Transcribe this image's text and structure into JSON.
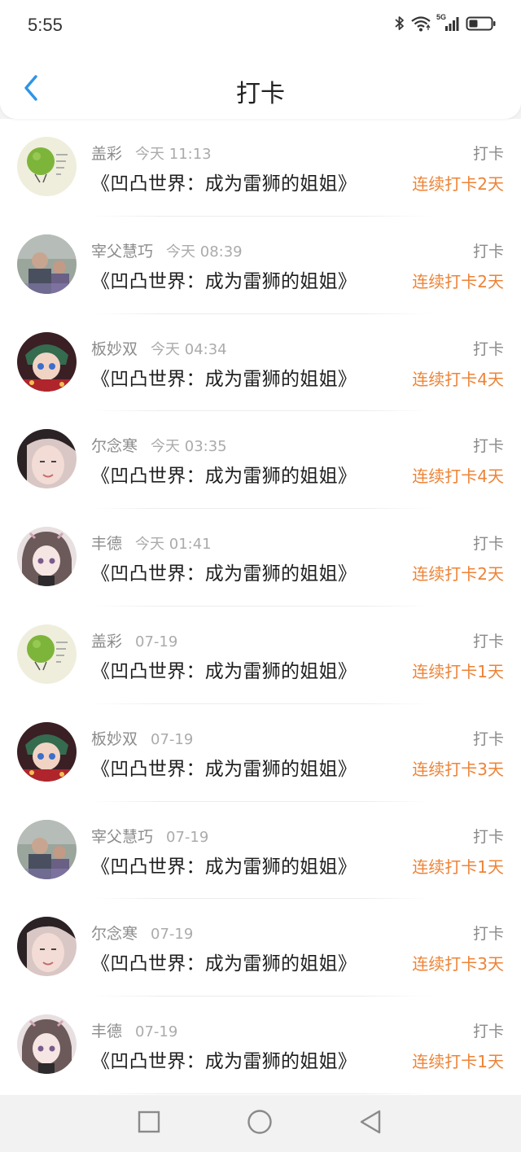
{
  "status_bar": {
    "time": "5:55",
    "icons": [
      "bluetooth-icon",
      "wifi-icon",
      "signal-5g-icon",
      "battery-icon"
    ],
    "network_label": "5G"
  },
  "header": {
    "title": "打卡",
    "back_icon": "chevron-left-icon",
    "accent_color": "#2f94e6"
  },
  "colors": {
    "streak": "#ee8336",
    "name": "#8c8c8c",
    "time": "#ababab",
    "book": "#1f1f1f"
  },
  "list": [
    {
      "name": "盖彩",
      "time": "今天 11:13",
      "book": "《凹凸世界：成为雷狮的姐姐》",
      "action": "打卡",
      "streak": "连续打卡2天",
      "avatar": "lime"
    },
    {
      "name": "宰父慧巧",
      "time": "今天 08:39",
      "book": "《凹凸世界：成为雷狮的姐姐》",
      "action": "打卡",
      "streak": "连续打卡2天",
      "avatar": "photo"
    },
    {
      "name": "板妙双",
      "time": "今天 04:34",
      "book": "《凹凸世界：成为雷狮的姐姐》",
      "action": "打卡",
      "streak": "连续打卡4天",
      "avatar": "anime-red"
    },
    {
      "name": "尔念寒",
      "time": "今天 03:35",
      "book": "《凹凸世界：成为雷狮的姐姐》",
      "action": "打卡",
      "streak": "连续打卡4天",
      "avatar": "face"
    },
    {
      "name": "丰德",
      "time": "今天 01:41",
      "book": "《凹凸世界：成为雷狮的姐姐》",
      "action": "打卡",
      "streak": "连续打卡2天",
      "avatar": "anime-doll"
    },
    {
      "name": "盖彩",
      "time": "07-19",
      "book": "《凹凸世界：成为雷狮的姐姐》",
      "action": "打卡",
      "streak": "连续打卡1天",
      "avatar": "lime"
    },
    {
      "name": "板妙双",
      "time": "07-19",
      "book": "《凹凸世界：成为雷狮的姐姐》",
      "action": "打卡",
      "streak": "连续打卡3天",
      "avatar": "anime-red"
    },
    {
      "name": "宰父慧巧",
      "time": "07-19",
      "book": "《凹凸世界：成为雷狮的姐姐》",
      "action": "打卡",
      "streak": "连续打卡1天",
      "avatar": "photo"
    },
    {
      "name": "尔念寒",
      "time": "07-19",
      "book": "《凹凸世界：成为雷狮的姐姐》",
      "action": "打卡",
      "streak": "连续打卡3天",
      "avatar": "face"
    },
    {
      "name": "丰德",
      "time": "07-19",
      "book": "《凹凸世界：成为雷狮的姐姐》",
      "action": "打卡",
      "streak": "连续打卡1天",
      "avatar": "anime-doll"
    }
  ],
  "bottom_nav": {
    "icons": [
      "square-recents-icon",
      "circle-home-icon",
      "triangle-back-icon"
    ]
  }
}
